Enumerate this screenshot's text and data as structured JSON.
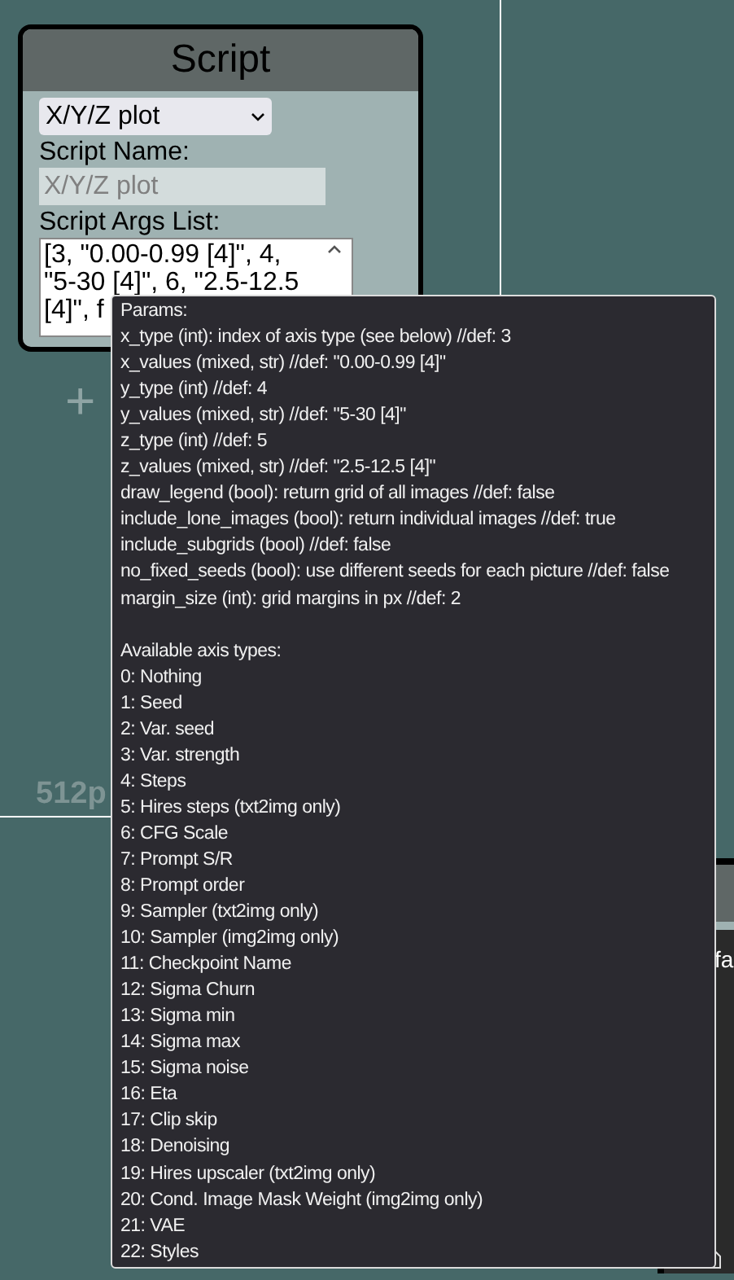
{
  "script_card": {
    "title": "Script",
    "dropdown": {
      "value": "X/Y/Z plot"
    },
    "name_label": "Script Name:",
    "name_field": {
      "value": "X/Y/Z plot",
      "disabled": true
    },
    "args_label": "Script Args List:",
    "args_field": {
      "value": "[3, \"0.00-0.99 [4]\", 4, \"5-30 [4]\", 6, \"2.5-12.5 [4]\", f"
    }
  },
  "add_label": "+",
  "size_label": "512p",
  "side_panel": {
    "text": "fa"
  },
  "tooltip": {
    "params_title": "Params:",
    "params": [
      "x_type (int): index of axis type (see below) //def: 3",
      "x_values (mixed, str) //def: \"0.00-0.99 [4]\"",
      "y_type (int) //def: 4",
      "y_values (mixed, str) //def: \"5-30 [4]\"",
      "z_type (int) //def: 5",
      "z_values (mixed, str) //def: \"2.5-12.5 [4]\"",
      "draw_legend (bool): return grid of all images //def: false",
      "include_lone_images (bool): return individual images //def: true",
      "include_subgrids (bool) //def: false",
      "no_fixed_seeds (bool): use different seeds for each picture //def: false",
      "margin_size (int): grid margins in px //def: 2"
    ],
    "axis_title": "Available axis types:",
    "axis_types": [
      "0: Nothing",
      "1: Seed",
      "2: Var. seed",
      "3: Var. strength",
      "4: Steps",
      "5: Hires steps (txt2img only)",
      "6: CFG Scale",
      "7: Prompt S/R",
      "8: Prompt order",
      "9: Sampler (txt2img only)",
      "10: Sampler (img2img only)",
      "11: Checkpoint Name",
      "12: Sigma Churn",
      "13: Sigma min",
      "14: Sigma max",
      "15: Sigma noise",
      "16: Eta",
      "17: Clip skip",
      "18: Denoising",
      "19: Hires upscaler (txt2img only)",
      "20: Cond. Image Mask Weight (img2img only)",
      "21: VAE",
      "22: Styles"
    ]
  }
}
